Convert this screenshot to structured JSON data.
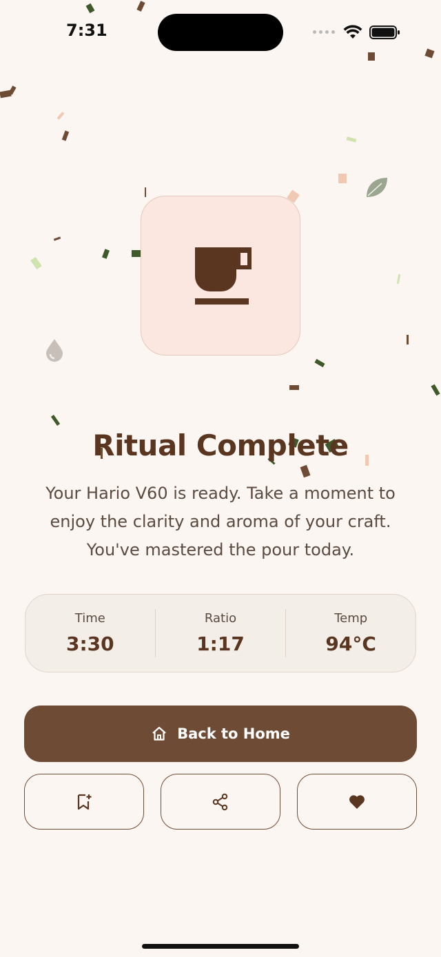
{
  "status_bar": {
    "time": "7:31"
  },
  "hero": {
    "icon": "coffee-cup-icon"
  },
  "title": "Ritual Complete",
  "description": "Your Hario V60 is ready. Take a moment to enjoy the clarity and aroma of your craft. You've mastered the pour today.",
  "stats": [
    {
      "label": "Time",
      "value": "3:30"
    },
    {
      "label": "Ratio",
      "value": "1:17"
    },
    {
      "label": "Temp",
      "value": "94°C"
    }
  ],
  "actions": {
    "primary": {
      "label": "Back to Home",
      "icon": "home-icon"
    },
    "secondary": [
      {
        "icon": "bookmark-add-icon"
      },
      {
        "icon": "share-icon"
      },
      {
        "icon": "heart-icon"
      }
    ]
  },
  "colors": {
    "background": "#fcf6f2",
    "accent": "#6e4b35",
    "title": "#5a3621",
    "card": "#fbe7df"
  }
}
